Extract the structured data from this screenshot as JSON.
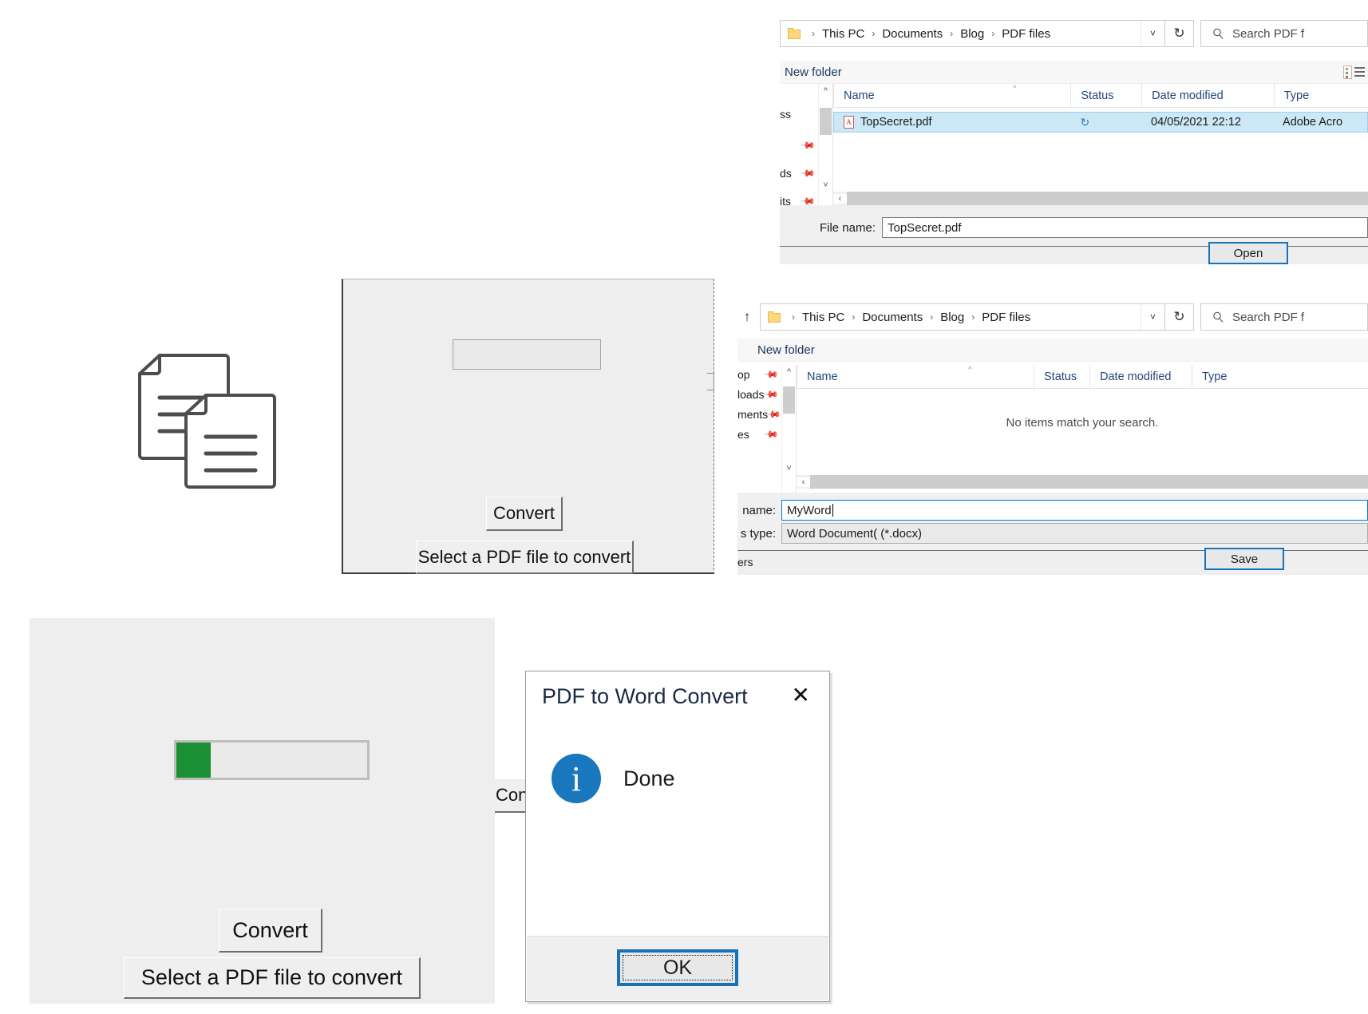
{
  "app": {
    "name": "PDF to Word Convert",
    "convert_label": "Convert",
    "select_label": "Select a PDF file to convert",
    "progress_percent": 18,
    "progress_color": "#1a8f33"
  },
  "open_dialog": {
    "breadcrumbs": [
      "This PC",
      "Documents",
      "Blog",
      "PDF files"
    ],
    "crumb_separator": "›",
    "folder_icon": "folder-icon",
    "caret_icon": "chevron-down-icon",
    "refresh_icon": "refresh-icon",
    "search": {
      "icon": "search-icon",
      "placeholder": "Search PDF f"
    },
    "command_bar": {
      "new_folder": "New folder",
      "view_icon": "view-layout-icon"
    },
    "nav_pane_items": [
      "ss",
      "",
      "ds",
      "its"
    ],
    "columns": [
      "Name",
      "Status",
      "Date modified",
      "Type"
    ],
    "rows": [
      {
        "name": "TopSecret.pdf",
        "status_icon": "cloud-sync-icon",
        "date_modified": "04/05/2021 22:12",
        "type": "Adobe Acro",
        "selected": true,
        "file_icon": "pdf-file-icon"
      }
    ],
    "file_name_label": "File name:",
    "file_name_value": "TopSecret.pdf",
    "open_button": "Open"
  },
  "save_dialog": {
    "up_icon": "up-arrow-icon",
    "breadcrumbs": [
      "This PC",
      "Documents",
      "Blog",
      "PDF files"
    ],
    "crumb_separator": "›",
    "folder_icon": "folder-icon",
    "caret_icon": "chevron-down-icon",
    "refresh_icon": "refresh-icon",
    "search": {
      "icon": "search-icon",
      "placeholder": "Search PDF f"
    },
    "command_bar": {
      "new_folder": "New folder"
    },
    "nav_pane_items": [
      "op",
      "loads",
      "ments",
      "es"
    ],
    "columns": [
      "Name",
      "Status",
      "Date modified",
      "Type"
    ],
    "empty_message": "No items match your search.",
    "file_name_label": "name:",
    "file_name_value": "MyWord",
    "save_type_label": "s type:",
    "save_type_value": "Word Document( (*.docx)",
    "hide_folders_label": "ers",
    "save_button": "Save"
  },
  "message_box": {
    "title": "PDF to Word Convert",
    "close_icon": "close-icon",
    "info_icon": "info-icon",
    "info_glyph": "i",
    "message": "Done",
    "ok_button": "OK",
    "accent_color": "#1673b9",
    "info_color": "#1877bd"
  },
  "doc_icon": {
    "name": "documents-copy-icon"
  }
}
